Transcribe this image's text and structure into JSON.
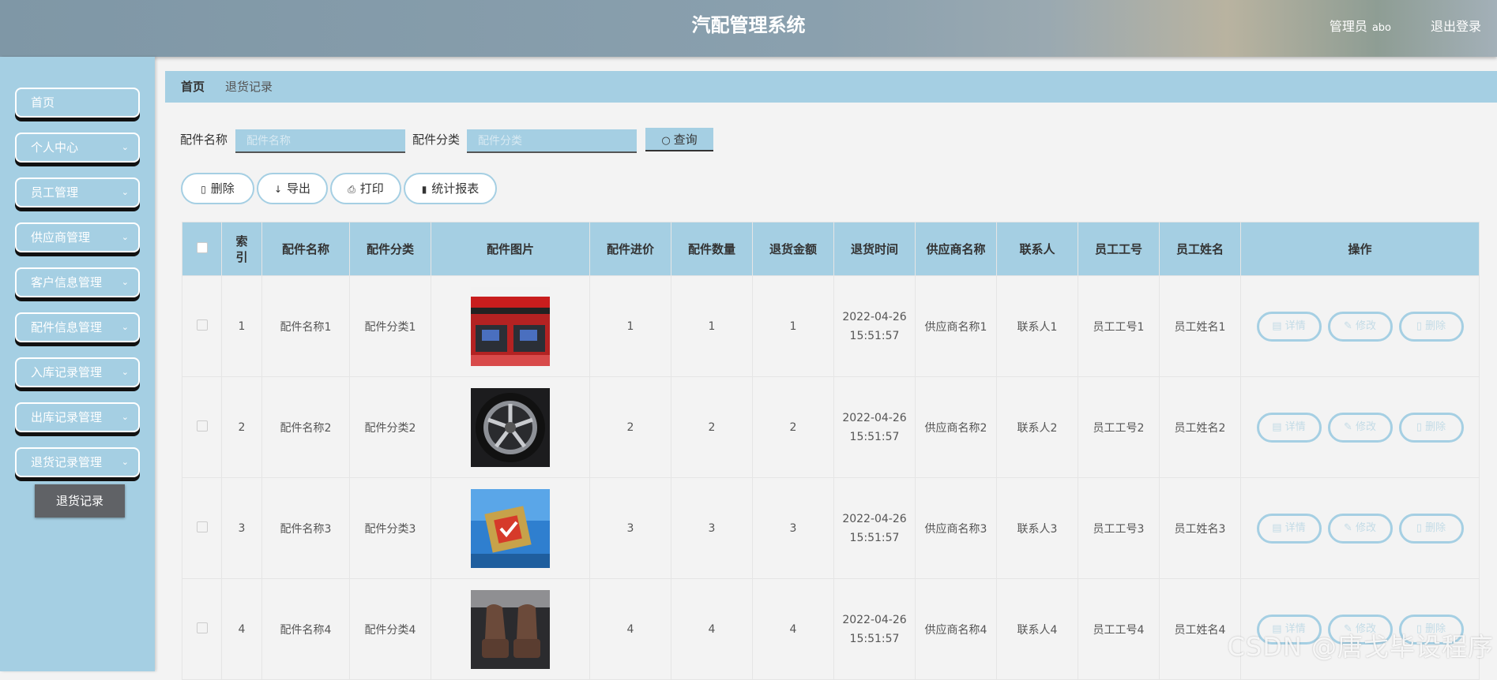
{
  "header": {
    "title": "汽配管理系统",
    "role": "管理员",
    "username": "abo",
    "logout": "退出登录"
  },
  "sidebar": {
    "items": [
      {
        "label": "首页",
        "has_arrow": false
      },
      {
        "label": "个人中心",
        "has_arrow": true
      },
      {
        "label": "员工管理",
        "has_arrow": true
      },
      {
        "label": "供应商管理",
        "has_arrow": true
      },
      {
        "label": "客户信息管理",
        "has_arrow": true
      },
      {
        "label": "配件信息管理",
        "has_arrow": true
      },
      {
        "label": "入库记录管理",
        "has_arrow": true
      },
      {
        "label": "出库记录管理",
        "has_arrow": true
      },
      {
        "label": "退货记录管理",
        "has_arrow": true
      }
    ],
    "submenu": "退货记录",
    "chevron": "⌄"
  },
  "breadcrumb": {
    "home": "首页",
    "current": "退货记录"
  },
  "search": {
    "name_label": "配件名称",
    "name_placeholder": "配件名称",
    "category_label": "配件分类",
    "category_placeholder": "配件分类",
    "query_label": "查询"
  },
  "actions": {
    "delete": "删除",
    "export": "导出",
    "print": "打印",
    "stats": "统计报表"
  },
  "table": {
    "headers": [
      "",
      "索引",
      "配件名称",
      "配件分类",
      "配件图片",
      "配件进价",
      "配件数量",
      "退货金额",
      "退货时间",
      "供应商名称",
      "联系人",
      "员工工号",
      "员工姓名",
      "操作"
    ],
    "rows": [
      {
        "index": "1",
        "name": "配件名称1",
        "category": "配件分类1",
        "price": "1",
        "qty": "1",
        "amount": "1",
        "date": "2022-04-26",
        "time": "15:51:57",
        "supplier": "供应商名称1",
        "contact": "联系人1",
        "emp_no": "员工工号1",
        "emp_name": "员工姓名1",
        "image": "engine-tuning-product-image"
      },
      {
        "index": "2",
        "name": "配件名称2",
        "category": "配件分类2",
        "price": "2",
        "qty": "2",
        "amount": "2",
        "date": "2022-04-26",
        "time": "15:51:57",
        "supplier": "供应商名称2",
        "contact": "联系人2",
        "emp_no": "员工工号2",
        "emp_name": "员工姓名2",
        "image": "alloy-wheel-image"
      },
      {
        "index": "3",
        "name": "配件名称3",
        "category": "配件分类3",
        "price": "3",
        "qty": "3",
        "amount": "3",
        "date": "2022-04-26",
        "time": "15:51:57",
        "supplier": "供应商名称3",
        "contact": "联系人3",
        "emp_no": "员工工号3",
        "emp_name": "员工姓名3",
        "image": "chip-module-image"
      },
      {
        "index": "4",
        "name": "配件名称4",
        "category": "配件分类4",
        "price": "4",
        "qty": "4",
        "amount": "4",
        "date": "2022-04-26",
        "time": "15:51:57",
        "supplier": "供应商名称4",
        "contact": "联系人4",
        "emp_no": "员工工号4",
        "emp_name": "员工姓名4",
        "image": "seat-cushion-image"
      }
    ],
    "row_actions": {
      "detail": "详情",
      "edit": "修改",
      "delete": "删除"
    }
  },
  "overlay": {
    "watermark": "CSDN @唐戈毕设程序"
  },
  "colors": {
    "accent": "#a5cfe3",
    "submenu_bg": "#606266",
    "page_bg": "#f3f3f3"
  }
}
